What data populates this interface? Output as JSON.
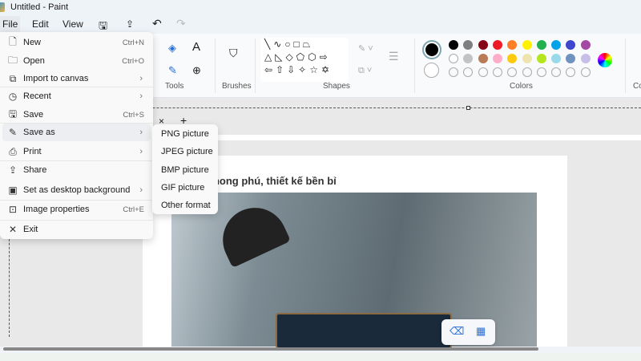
{
  "title": "Untitled - Paint",
  "menubar": {
    "file": "File",
    "edit": "Edit",
    "view": "View"
  },
  "ribbon": {
    "tools_label": "Tools",
    "brushes_label": "Brushes",
    "shapes_label": "Shapes",
    "colors_label": "Colors",
    "next_label": "Co",
    "colors_row1": [
      "#000000",
      "#7f7f7f",
      "#880015",
      "#ed1c24",
      "#ff7f27",
      "#fff200",
      "#22b14c",
      "#00a2e8",
      "#3f48cc",
      "#a349a4"
    ],
    "colors_row2": [
      "#ffffff",
      "#c3c3c3",
      "#b97a57",
      "#ffaec9",
      "#ffc90e",
      "#efe4b0",
      "#b5e61d",
      "#99d9ea",
      "#7092be",
      "#c8bfe7"
    ],
    "primary_color": "#000000",
    "secondary_color": "#ffffff"
  },
  "file_menu": [
    {
      "label": "New",
      "shortcut": "Ctrl+N",
      "icon": "new-file-icon"
    },
    {
      "label": "Open",
      "shortcut": "Ctrl+O",
      "icon": "folder-icon"
    },
    {
      "label": "Import to canvas",
      "submenu": true,
      "icon": "import-icon"
    },
    {
      "label": "Recent",
      "submenu": true,
      "icon": "clock-icon"
    },
    {
      "label": "Save",
      "shortcut": "Ctrl+S",
      "icon": "save-icon"
    },
    {
      "label": "Save as",
      "submenu": true,
      "icon": "save-as-icon",
      "active": true
    },
    {
      "label": "Print",
      "submenu": true,
      "icon": "print-icon"
    },
    {
      "label": "Share",
      "icon": "share-icon"
    },
    {
      "label": "Set as desktop background",
      "submenu": true,
      "icon": "desktop-icon"
    },
    {
      "label": "Image properties",
      "shortcut": "Ctrl+E",
      "icon": "image-properties-icon"
    },
    {
      "label": "Exit",
      "icon": "close-icon"
    }
  ],
  "save_as_menu": [
    "PNG picture",
    "JPEG picture",
    "BMP picture",
    "GIF picture",
    "Other format"
  ],
  "canvas": {
    "text": "phong phú, thiết kế bền bỉ"
  }
}
